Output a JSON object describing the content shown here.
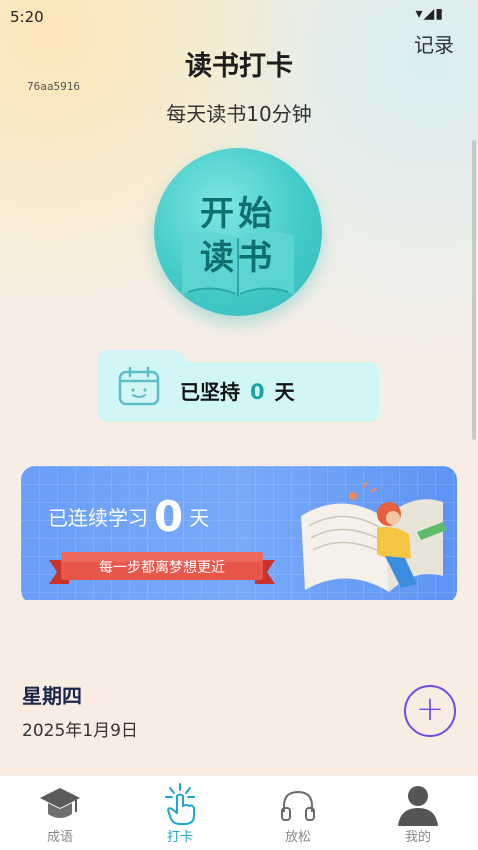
{
  "status_bar": {
    "time": "5:20",
    "icons": "▾◢▮"
  },
  "header": {
    "record_label": "记录",
    "debug_id": "76aa5916",
    "title": "读书打卡",
    "subtitle": "每天读书10分钟"
  },
  "start_button": {
    "line1": "开始",
    "line2": "读书"
  },
  "persist_card": {
    "prefix": "已坚持",
    "count": "0",
    "suffix": "天"
  },
  "streak_banner": {
    "prefix": "已连续学习",
    "count": "0",
    "suffix": "天",
    "ribbon": "每一步都离梦想更近"
  },
  "day_section": {
    "weekday": "星期四",
    "date": "2025年1月9日",
    "add_icon": "+"
  },
  "bottom_nav": {
    "items": [
      {
        "label": "成语",
        "icon": "graduation-cap-icon"
      },
      {
        "label": "打卡",
        "icon": "tap-hand-icon"
      },
      {
        "label": "放松",
        "icon": "headphones-icon"
      },
      {
        "label": "我的",
        "icon": "person-icon"
      }
    ],
    "active_index": 1
  },
  "colors": {
    "accent_teal": "#1fa2a2",
    "banner_blue": "#6a9ef8",
    "add_button_purple": "#6a4ee8",
    "nav_active": "#1ca8c9"
  }
}
